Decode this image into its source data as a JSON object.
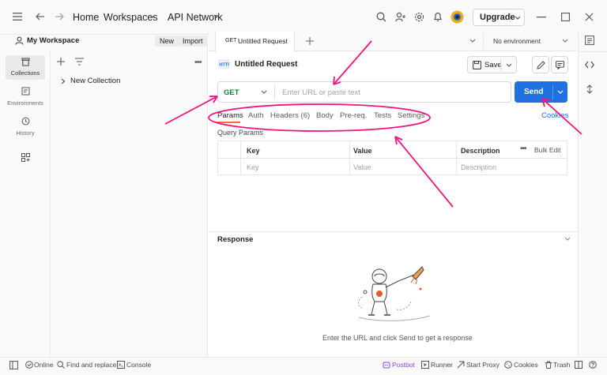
{
  "topbar": {
    "home": "Home",
    "workspaces": "Workspaces",
    "api_network": "API Network",
    "upgrade": "Upgrade"
  },
  "sidebar": {
    "workspace_name": "My Workspace",
    "new_label": "New",
    "import_label": "Import",
    "rail": [
      {
        "label": "Collections",
        "icon": "collections-icon"
      },
      {
        "label": "Environments",
        "icon": "environments-icon"
      },
      {
        "label": "History",
        "icon": "history-icon"
      }
    ],
    "tree": {
      "collection": "New Collection"
    }
  },
  "tab": {
    "method_badge": "GET",
    "title": "Untitled Request",
    "environment": "No environment"
  },
  "request": {
    "title": "Untitled Request",
    "save_label": "Save",
    "method": "GET",
    "url_placeholder": "Enter URL or paste text",
    "send_label": "Send",
    "cookies_label": "Cookies",
    "tabs": [
      "Params",
      "Auth",
      "Headers (6)",
      "Body",
      "Pre-req.",
      "Tests",
      "Settings"
    ],
    "query_params_title": "Query Params",
    "table": {
      "headers": {
        "key": "Key",
        "value": "Value",
        "description": "Description",
        "bulk_edit": "Bulk Edit"
      },
      "row": {
        "key": "Key",
        "value": "Value",
        "description": "Description"
      }
    }
  },
  "response": {
    "title": "Response",
    "empty_message": "Enter the URL and click Send to get a response"
  },
  "statusbar": {
    "online": "Online",
    "find_replace": "Find and replace",
    "console": "Console",
    "postbot": "Postbot",
    "runner": "Runner",
    "start_proxy": "Start Proxy",
    "cookies": "Cookies",
    "trash": "Trash"
  },
  "colors": {
    "accent": "#1f70e0",
    "annotation": "#f0147f",
    "method_get": "#0f8a3a",
    "brand_orange": "#ff6c37"
  }
}
